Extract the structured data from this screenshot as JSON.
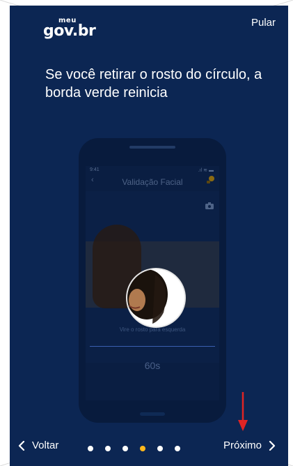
{
  "header": {
    "logo_top": "meu",
    "logo_main": "gov.br",
    "skip_label": "Pular"
  },
  "main": {
    "headline": "Se você retirar o rosto do círculo, a borda verde reinicia"
  },
  "phone_mockup": {
    "status_time": "9:41",
    "status_icons": ".ıl ≋ ▬",
    "screen_title": "Validação Facial",
    "instruction": "Vire o rosto para esquerda",
    "timer": "60s"
  },
  "footer": {
    "back_label": "Voltar",
    "next_label": "Próximo",
    "page_count": 6,
    "active_page": 4
  },
  "colors": {
    "background": "#0c2653",
    "active_dot": "#ffb81c",
    "annotation_arrow": "#e02424"
  },
  "icons": {
    "back": "chevron-left-icon",
    "next": "chevron-right-icon",
    "annotation": "red-arrow-down-icon"
  }
}
